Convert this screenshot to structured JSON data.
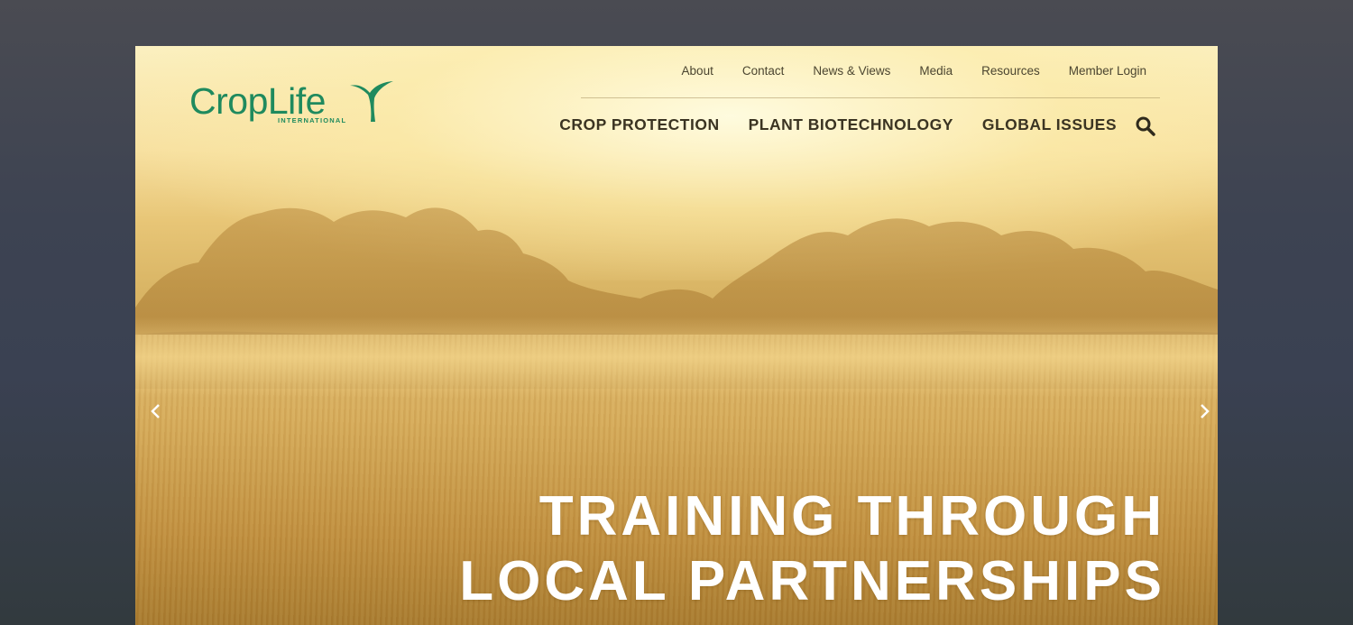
{
  "brand": {
    "name_main": "CropLife",
    "name_sub": "INTERNATIONAL",
    "color": "#1f8a5e"
  },
  "utility_nav": {
    "items": [
      {
        "label": "About"
      },
      {
        "label": "Contact"
      },
      {
        "label": "News & Views"
      },
      {
        "label": "Media"
      },
      {
        "label": "Resources"
      },
      {
        "label": "Member Login"
      }
    ]
  },
  "main_nav": {
    "items": [
      {
        "label": "CROP PROTECTION"
      },
      {
        "label": "PLANT BIOTECHNOLOGY"
      },
      {
        "label": "GLOBAL ISSUES"
      }
    ],
    "search_icon": "search-icon"
  },
  "hero": {
    "headline_line1": "TRAINING THROUGH",
    "headline_line2": "LOCAL PARTNERSHIPS",
    "prev_icon": "chevron-left-icon",
    "next_icon": "chevron-right-icon"
  }
}
